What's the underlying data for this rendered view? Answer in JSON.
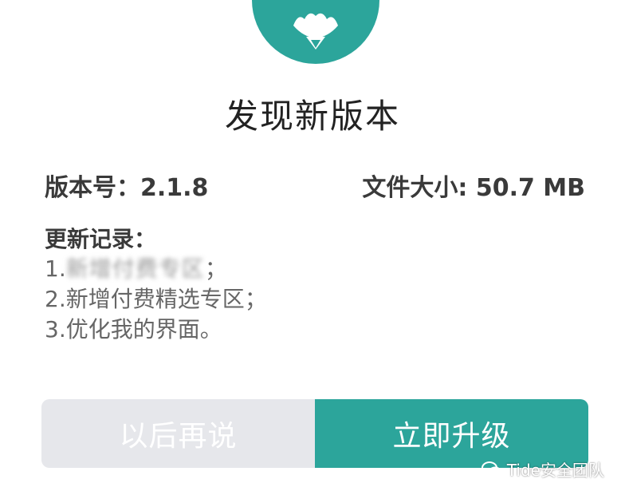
{
  "dialog": {
    "title": "发现新版本",
    "version_label": "版本号：2.1.8",
    "size_label": "文件大小: 50.7 MB",
    "notes_title": "更新记录：",
    "notes": [
      {
        "prefix": "1.",
        "text": "新增付费专区",
        "suffix": "；"
      },
      {
        "text": "2.新增付费精选专区；"
      },
      {
        "text": "3.优化我的界面。"
      }
    ]
  },
  "buttons": {
    "later": "以后再说",
    "upgrade": "立即升级"
  },
  "watermark": {
    "text": "Tide安全团队",
    "icon": "wechat-icon"
  },
  "colors": {
    "accent": "#2ca59b",
    "secondary_button": "#e6e7eb",
    "title": "#222222",
    "notes": "#666666"
  }
}
